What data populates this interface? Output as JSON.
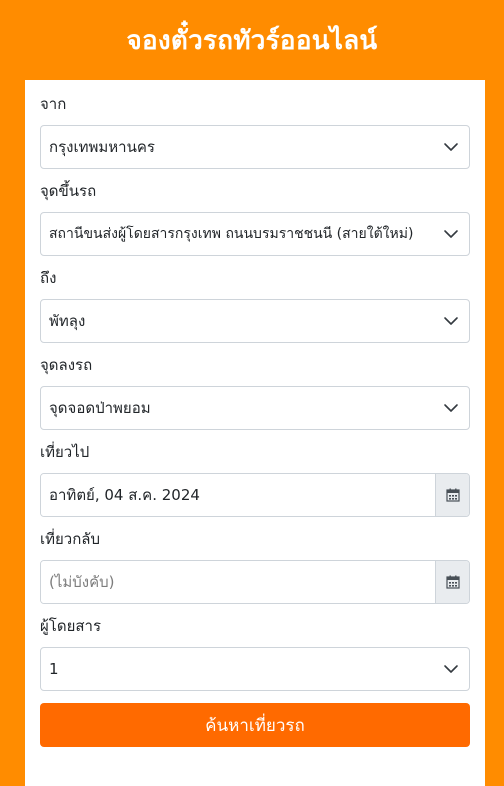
{
  "header": {
    "title": "จองตั๋วรถทัวร์ออนไลน์"
  },
  "form": {
    "from": {
      "label": "จาก",
      "value": "กรุงเทพมหานคร"
    },
    "pickup": {
      "label": "จุดขึ้นรถ",
      "value": "สถานีขนส่งผู้โดยสารกรุงเทพ ถนนบรมราชชนนี (สายใต้ใหม่)"
    },
    "to": {
      "label": "ถึง",
      "value": "พัทลุง"
    },
    "dropoff": {
      "label": "จุดลงรถ",
      "value": "จุดจอดป่าพยอม"
    },
    "depart": {
      "label": "เที่ยวไป",
      "value": "อาทิตย์, 04 ส.ค. 2024"
    },
    "return": {
      "label": "เที่ยวกลับ",
      "placeholder": "(ไม่บังคับ)"
    },
    "passengers": {
      "label": "ผู้โดยสาร",
      "value": "1"
    },
    "search_button": "ค้นหาเที่ยวรถ"
  },
  "colors": {
    "background": "#FF8C00",
    "button": "#FF6A00",
    "addon": "#e9ecef"
  },
  "icons": {
    "select": "chevron-down-icon",
    "calendar": "calendar-icon"
  }
}
